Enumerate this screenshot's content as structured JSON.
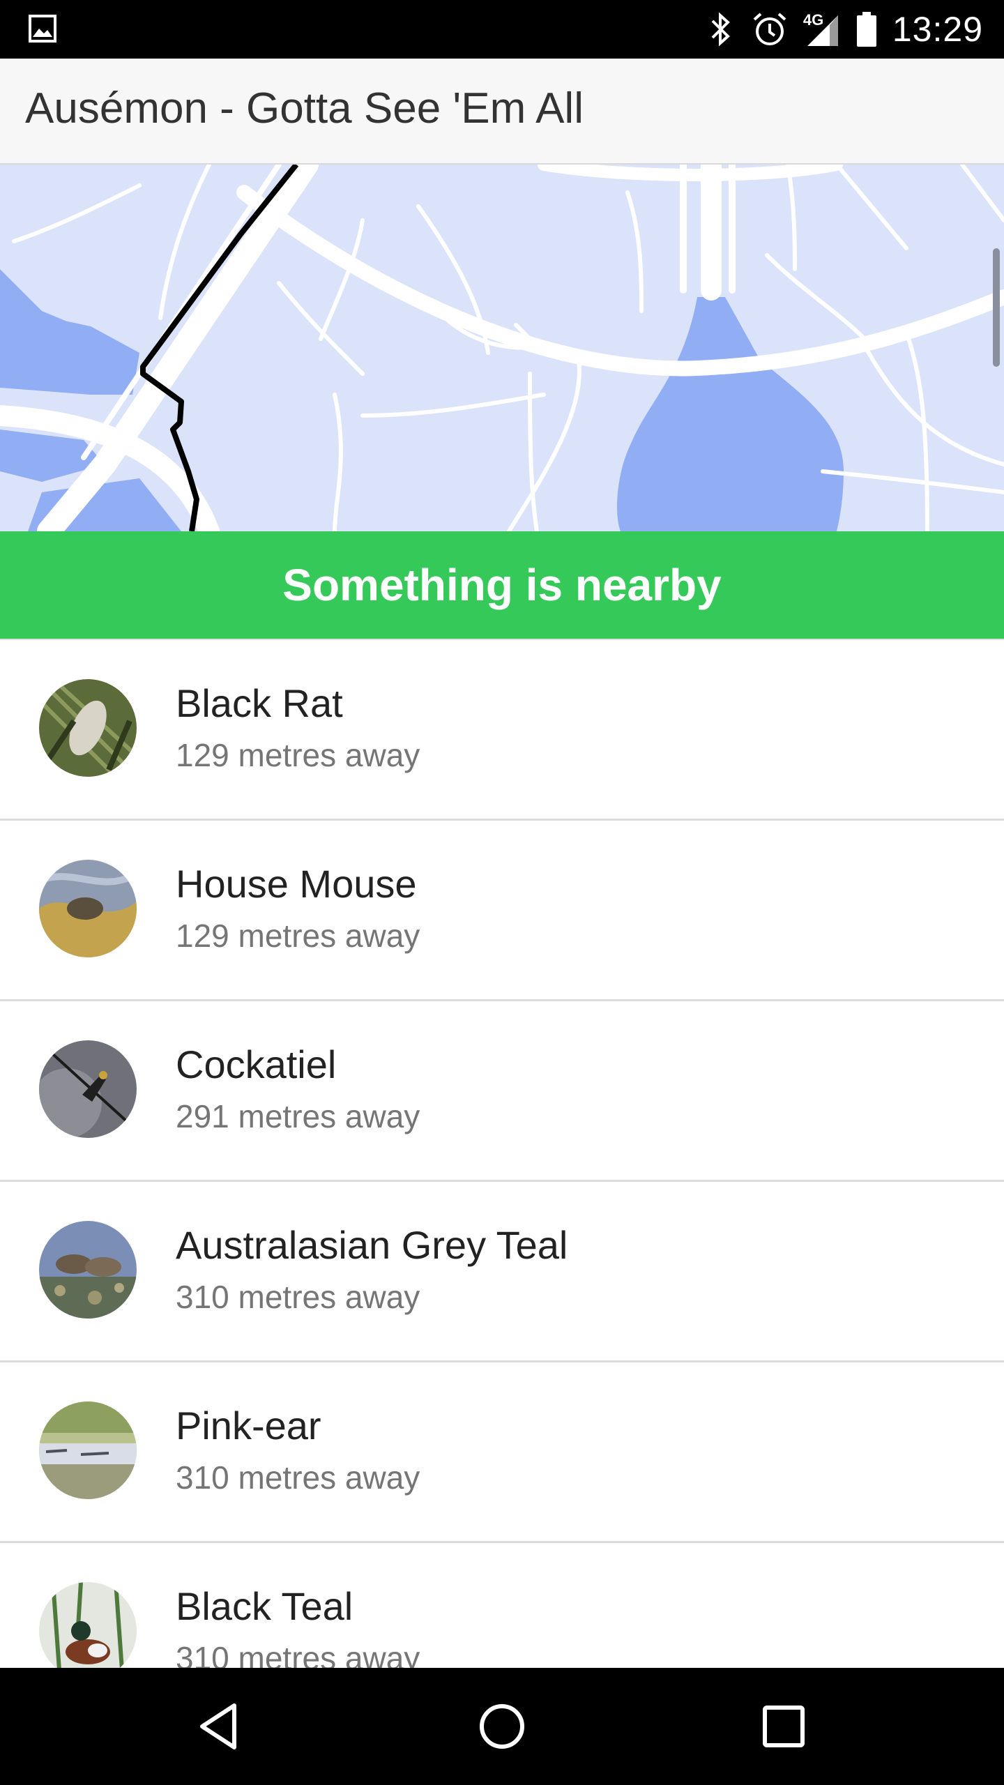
{
  "status_bar": {
    "time": "13:29",
    "network_label": "4G",
    "icons": [
      "image-icon",
      "bluetooth-icon",
      "alarm-icon",
      "signal-icon",
      "battery-icon"
    ]
  },
  "app_bar": {
    "title": "Ausémon - Gotta See 'Em All"
  },
  "map": {
    "colors": {
      "land": "#dbe3fb",
      "water": "#91aef4",
      "road": "#ffffff",
      "route": "#000000"
    }
  },
  "banner": {
    "text": "Something is nearby",
    "color": "#35c95a"
  },
  "species": [
    {
      "name": "Black Rat",
      "distance": "129 metres away",
      "thumb": "black-rat-thumbnail"
    },
    {
      "name": "House Mouse",
      "distance": "129 metres away",
      "thumb": "house-mouse-thumbnail"
    },
    {
      "name": "Cockatiel",
      "distance": "291 metres away",
      "thumb": "cockatiel-thumbnail"
    },
    {
      "name": "Australasian Grey Teal",
      "distance": "310 metres away",
      "thumb": "grey-teal-thumbnail"
    },
    {
      "name": "Pink-ear",
      "distance": "310 metres away",
      "thumb": "pink-ear-thumbnail"
    },
    {
      "name": "Black Teal",
      "distance": "310 metres away",
      "thumb": "black-teal-thumbnail"
    }
  ],
  "nav_bar": {
    "buttons": [
      "back-icon",
      "home-icon",
      "recents-icon"
    ]
  }
}
